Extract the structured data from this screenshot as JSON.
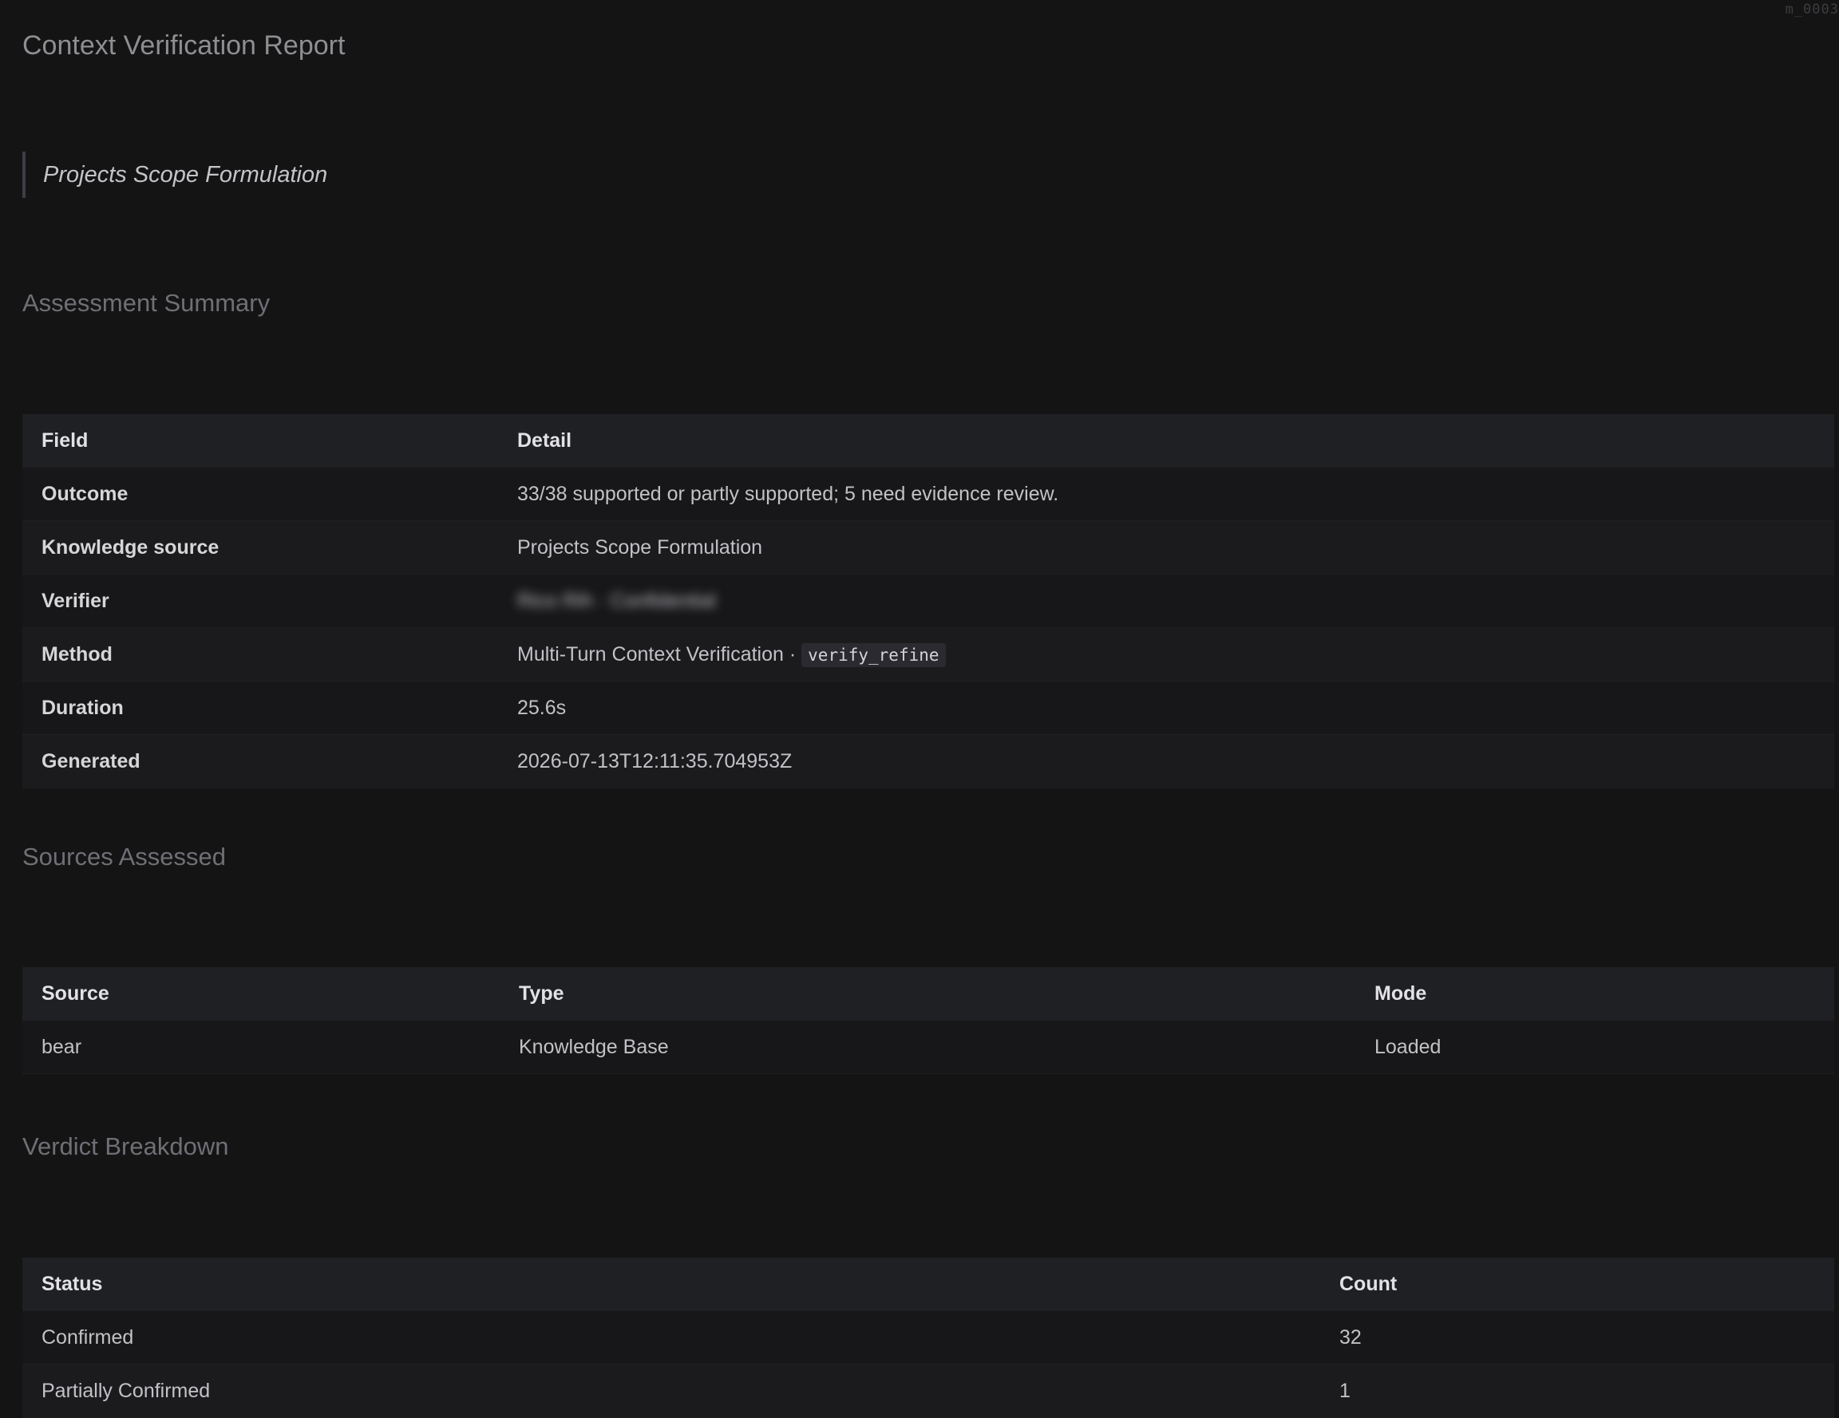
{
  "corner_tag": "m_0003",
  "report": {
    "title": "Context Verification Report",
    "subtitle": "Projects Scope Formulation"
  },
  "assessment_summary": {
    "heading": "Assessment Summary",
    "columns": [
      "Field",
      "Detail"
    ],
    "rows": [
      {
        "field": "Outcome",
        "detail": "33/38 supported or partly supported; 5 need evidence review."
      },
      {
        "field": "Knowledge source",
        "detail": "Projects Scope Formulation"
      },
      {
        "field": "Verifier",
        "detail": "Rico Rih · Confidential"
      },
      {
        "field": "Method",
        "detail": "Multi-Turn Context Verification ·",
        "code": "verify_refine"
      },
      {
        "field": "Duration",
        "detail": "25.6s"
      },
      {
        "field": "Generated",
        "detail": "2026-07-13T12:11:35.704953Z"
      }
    ]
  },
  "sources_assessed": {
    "heading": "Sources Assessed",
    "columns": [
      "Source",
      "Type",
      "Mode"
    ],
    "rows": [
      {
        "source": "bear",
        "type": "Knowledge Base",
        "mode": "Loaded"
      }
    ]
  },
  "verdict_breakdown": {
    "heading": "Verdict Breakdown",
    "columns": [
      "Status",
      "Count"
    ],
    "rows": [
      {
        "status": "Confirmed",
        "count": "32"
      },
      {
        "status": "Partially Confirmed",
        "count": "1"
      }
    ]
  }
}
